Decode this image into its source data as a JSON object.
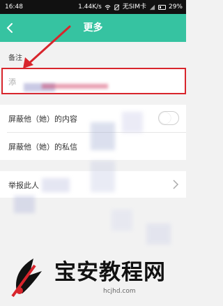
{
  "status_bar": {
    "time": "16:48",
    "network_speed": "1.44K/s",
    "carrier": "无SIM卡",
    "battery": "29%"
  },
  "header": {
    "title": "更多",
    "back_icon": "chevron-left-icon"
  },
  "remark": {
    "label": "备注",
    "placeholder": "添",
    "value": ""
  },
  "privacy": {
    "items": [
      {
        "label": "屏蔽他（她）的内容",
        "toggle": "off"
      },
      {
        "label": "屏蔽他（她）的私信",
        "toggle": "off"
      }
    ]
  },
  "report": {
    "label": "举报此人"
  },
  "watermark": {
    "text": "宝安教程网",
    "domain": "hcjhd.com"
  },
  "colors": {
    "header": "#36c3a1",
    "annotation": "#d8252c",
    "background": "#f2f2f2"
  }
}
